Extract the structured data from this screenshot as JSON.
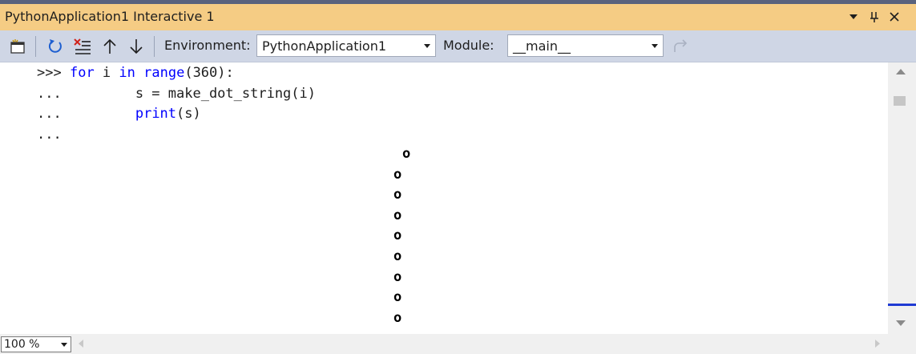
{
  "window": {
    "title": "PythonApplication1 Interactive 1"
  },
  "toolbar": {
    "environment_label": "Environment:",
    "environment_value": "PythonApplication1",
    "module_label": "Module:",
    "module_value": "__main__"
  },
  "console": {
    "lines": [
      {
        "prompt": ">>>",
        "segments": [
          {
            "text": " ",
            "kw": false
          },
          {
            "text": "for",
            "kw": true
          },
          {
            "text": " i ",
            "kw": false
          },
          {
            "text": "in",
            "kw": true
          },
          {
            "text": " ",
            "kw": false
          },
          {
            "text": "range",
            "kw": true
          },
          {
            "text": "(360):",
            "kw": false
          }
        ]
      },
      {
        "prompt": "...",
        "segments": [
          {
            "text": "         s = make_dot_string(i)",
            "kw": false
          }
        ]
      },
      {
        "prompt": "...",
        "segments": [
          {
            "text": "         ",
            "kw": false
          },
          {
            "text": "print",
            "kw": true
          },
          {
            "text": "(s)",
            "kw": false
          }
        ]
      },
      {
        "prompt": "...",
        "segments": []
      }
    ],
    "output": [
      "o",
      "o",
      "o",
      "o",
      "o",
      "o",
      "o",
      "o",
      "o"
    ]
  },
  "statusbar": {
    "zoom": "100 %"
  },
  "colors": {
    "title_bg": "#f5cc84",
    "toolbar_bg": "#cfd6e5",
    "keyword": "#0000ff",
    "scroll_marker": "#1f3ad3"
  }
}
